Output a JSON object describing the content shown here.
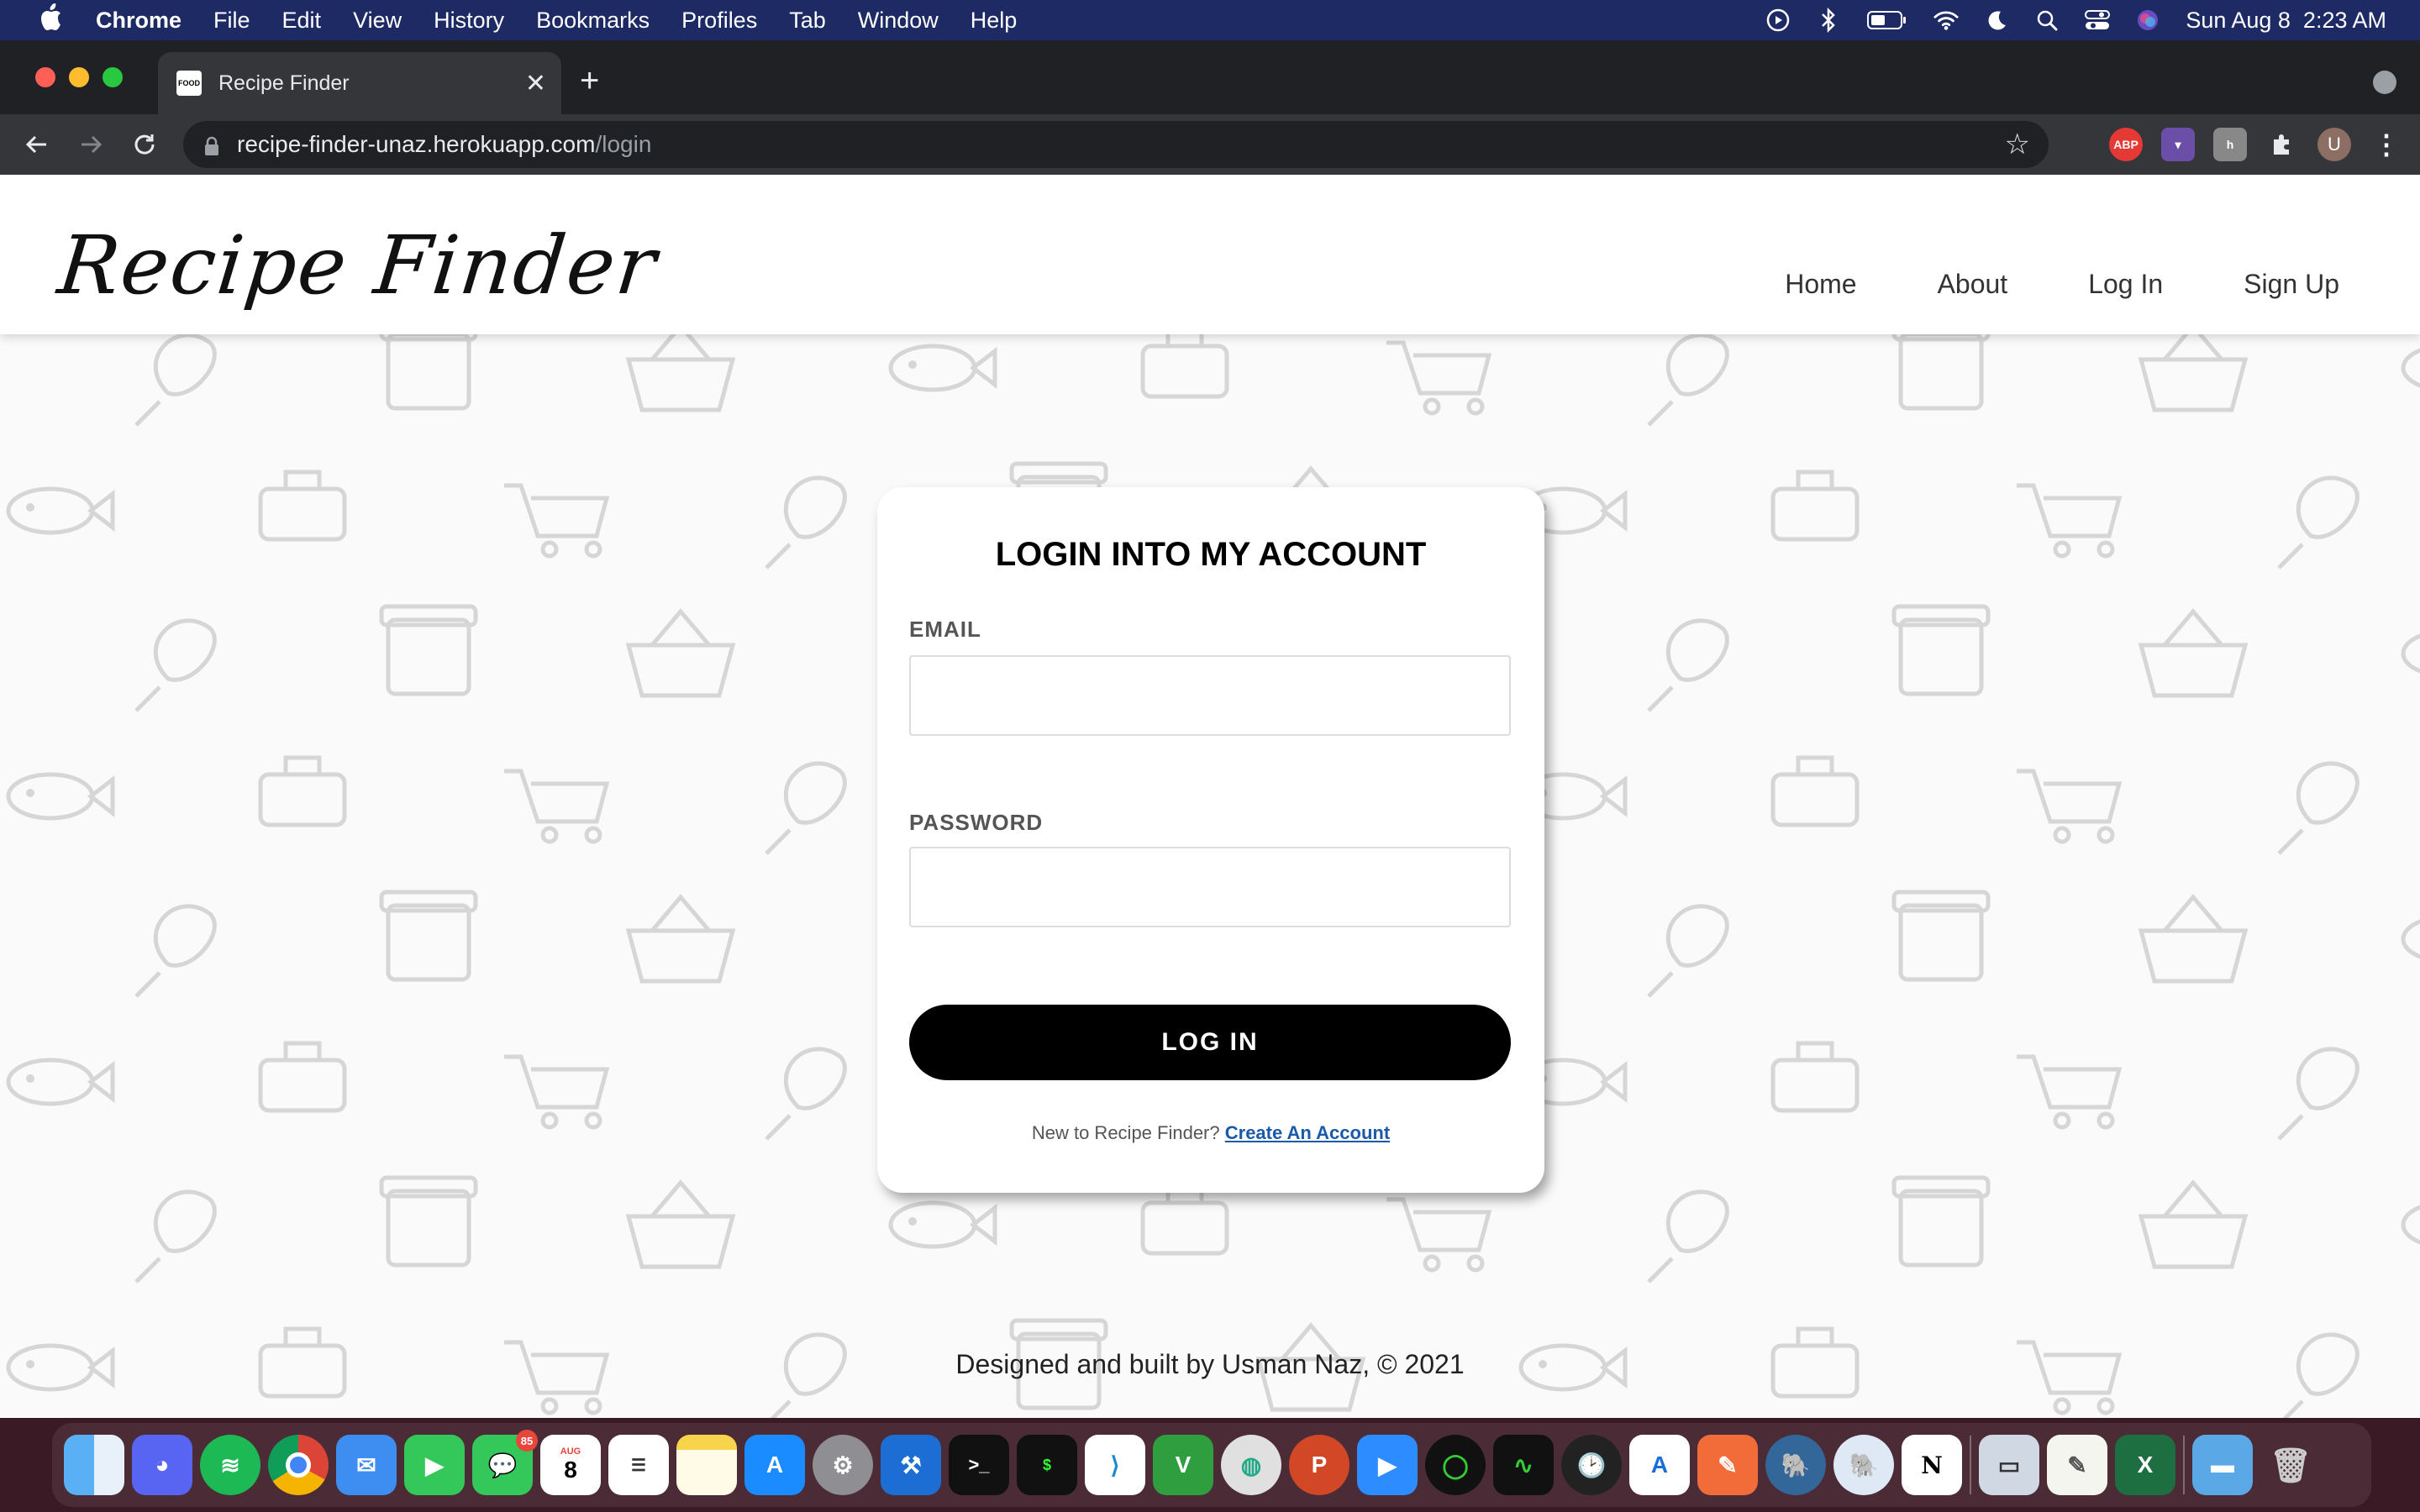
{
  "menubar": {
    "app_name": "Chrome",
    "items": [
      "File",
      "Edit",
      "View",
      "History",
      "Bookmarks",
      "Profiles",
      "Tab",
      "Window",
      "Help"
    ],
    "datetime": "Sun Aug 8  2:23 AM"
  },
  "browser": {
    "tab_title": "Recipe Finder",
    "favicon_text": "FOOD",
    "url_host": "recipe-finder-unaz.herokuapp.com",
    "url_path": "/login",
    "ext_abp": "ABP",
    "avatar": "U"
  },
  "site": {
    "logo": "Recipe Finder",
    "nav": [
      "Home",
      "About",
      "Log In",
      "Sign Up"
    ]
  },
  "login": {
    "title": "LOGIN INTO MY ACCOUNT",
    "email_label": "EMAIL",
    "email_value": "",
    "password_label": "PASSWORD",
    "password_value": "",
    "button": "LOG IN",
    "signup_prompt": "New to Recipe Finder?",
    "signup_link": "Create An Account"
  },
  "footer": "Designed and built by Usman Naz, © 2021",
  "dock": {
    "messages_badge": "85",
    "calendar_month": "AUG",
    "calendar_day": "8",
    "apps": [
      "Finder",
      "Discord",
      "Spotify",
      "Chrome",
      "Mail",
      "FaceTime",
      "Messages",
      "Calendar",
      "Reminders",
      "Notes",
      "App Store",
      "System Preferences",
      "Xcode",
      "Terminal",
      "Terminal 2",
      "VS Code",
      "Vim",
      "Network",
      "PowerPoint",
      "Zoom",
      "Activity",
      "Activity Monitor",
      "Clock",
      "Instruments",
      "Sketch",
      "TablePlus",
      "Postgres",
      "Notion",
      "Preview",
      "TextEdit",
      "Excel",
      "Folder",
      "Trash"
    ]
  },
  "colors": {
    "menubar_bg": "#1d2a63",
    "link": "#1a5aa8",
    "button_bg": "#000000"
  }
}
